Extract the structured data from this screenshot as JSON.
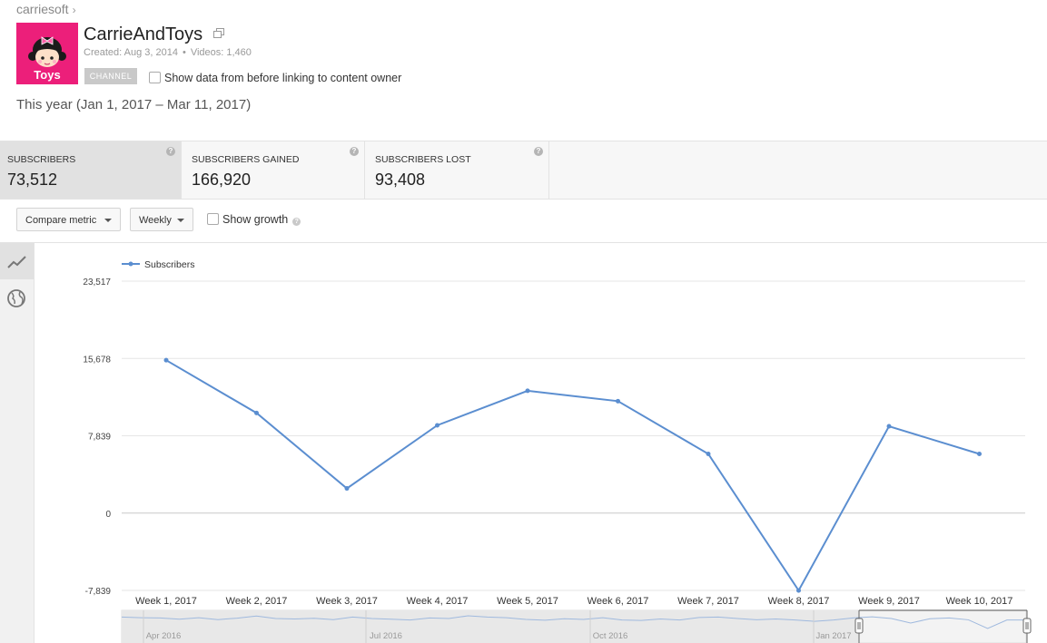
{
  "breadcrumb": {
    "label": "carriesoft",
    "chevron": "›"
  },
  "channel": {
    "avatar_text": "Toys",
    "title": "CarrieAndToys",
    "created": "Created: Aug 3, 2014",
    "separator": "•",
    "videos": "Videos: 1,460",
    "badge": "CHANNEL",
    "show_data_label": "Show data from before linking to content owner"
  },
  "date_range": "This year (Jan 1, 2017 – Mar 11, 2017)",
  "metrics": [
    {
      "label": "SUBSCRIBERS",
      "value": "73,512",
      "active": true
    },
    {
      "label": "SUBSCRIBERS GAINED",
      "value": "166,920",
      "active": false
    },
    {
      "label": "SUBSCRIBERS LOST",
      "value": "93,408",
      "active": false
    }
  ],
  "controls": {
    "compare_metric": "Compare metric",
    "interval": "Weekly",
    "show_growth": "Show growth",
    "help": "?"
  },
  "sidebar": {
    "icons": [
      "line-chart-icon",
      "globe-icon"
    ]
  },
  "colors": {
    "series": "#5b8ed0",
    "accent": "#ec1f7a",
    "grid": "#e6e6e6"
  },
  "chart_data": {
    "type": "line",
    "legend": "Subscribers",
    "legend_position": "top-left",
    "categories": [
      "Week 1, 2017",
      "Week 2, 2017",
      "Week 3, 2017",
      "Week 4, 2017",
      "Week 5, 2017",
      "Week 6, 2017",
      "Week 7, 2017",
      "Week 8, 2017",
      "Week 9, 2017",
      "Week 10, 2017"
    ],
    "series": [
      {
        "name": "Subscribers",
        "values": [
          15500,
          10150,
          2500,
          8900,
          12400,
          11350,
          6000,
          -7850,
          8800,
          6000
        ]
      }
    ],
    "y_ticks": [
      {
        "value": 23517,
        "label": "23,517"
      },
      {
        "value": 15678,
        "label": "15,678"
      },
      {
        "value": 7839,
        "label": "7,839"
      },
      {
        "value": 0,
        "label": "0"
      },
      {
        "value": -7839,
        "label": "-7,839"
      }
    ],
    "ylim": [
      -7839,
      23517
    ],
    "grid": true,
    "navigator": {
      "labels": [
        "Apr 2016",
        "Jul 2016",
        "Oct 2016",
        "Jan 2017"
      ],
      "values": [
        -0.2,
        -0.5,
        -0.6,
        -1.2,
        -0.5,
        -1.4,
        -0.7,
        0.3,
        -0.9,
        -1.1,
        -0.8,
        -1.4,
        -0.2,
        -0.9,
        -1.2,
        -1.6,
        -0.6,
        -0.9,
        0.4,
        -0.2,
        -0.5,
        -1.3,
        -1.7,
        -1.0,
        -1.3,
        -0.5,
        -1.6,
        -1.8,
        -1.1,
        -1.6,
        -0.4,
        -0.2,
        -0.9,
        -1.5,
        -1.1,
        -1.6,
        -2.2,
        -1.6,
        -0.6,
        -0.1,
        -0.9,
        -3.0,
        -1.0,
        -0.6,
        -1.5,
        -5.6,
        -1.6,
        -1.6
      ]
    }
  }
}
